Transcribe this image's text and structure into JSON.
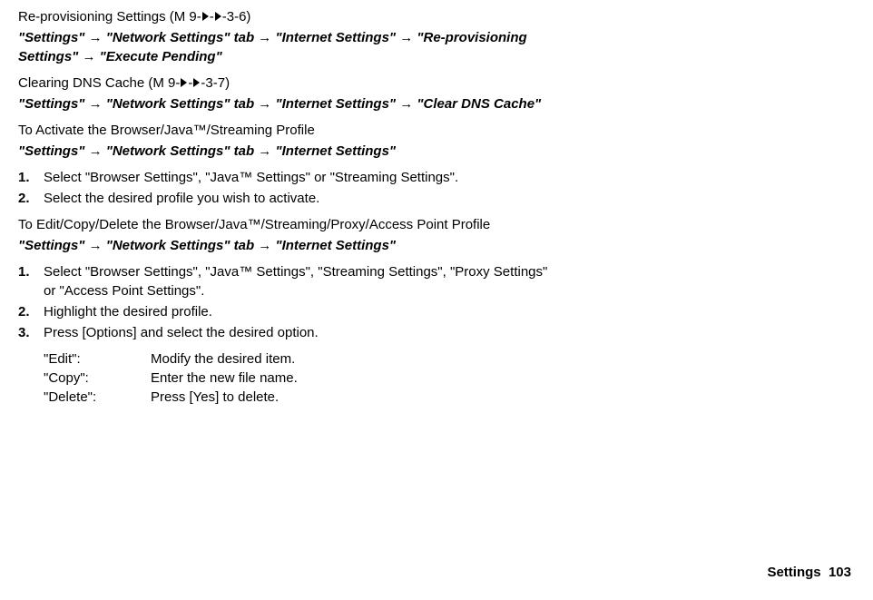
{
  "section1": {
    "title_prefix": "Re-provisioning Settings (M 9-",
    "title_suffix": "-3-6)",
    "nav": "\"Settings\" → \"Network Settings\" tab → \"Internet Settings\" → \"Re-provisioning Settings\" → \"Execute Pending\""
  },
  "section2": {
    "title_prefix": "Clearing DNS Cache (M 9-",
    "title_suffix": "-3-7)",
    "nav": "\"Settings\" → \"Network Settings\" tab → \"Internet Settings\" → \"Clear DNS Cache\""
  },
  "section3": {
    "subtitle": "To Activate the Browser/Java™/Streaming Profile",
    "nav": "\"Settings\" → \"Network Settings\" tab → \"Internet Settings\"",
    "steps": {
      "n1": "1.",
      "s1": "Select \"Browser Settings\", \"Java™ Settings\" or \"Streaming Settings\".",
      "n2": "2.",
      "s2": "Select the desired profile you wish to activate."
    }
  },
  "section4": {
    "subtitle": "To Edit/Copy/Delete the Browser/Java™/Streaming/Proxy/Access Point Profile",
    "nav": "\"Settings\" → \"Network Settings\" tab → \"Internet Settings\"",
    "steps": {
      "n1": "1.",
      "s1": "Select \"Browser Settings\", \"Java™ Settings\", \"Streaming Settings\", \"Proxy Settings\" or \"Access Point Settings\".",
      "n2": "2.",
      "s2": "Highlight the desired profile.",
      "n3": "3.",
      "s3": "Press [Options] and select the desired option."
    },
    "options": {
      "edit_label": "\"Edit\":",
      "edit_desc": "Modify the desired item.",
      "copy_label": "\"Copy\":",
      "copy_desc": "Enter the new file name.",
      "delete_label": "\"Delete\":",
      "delete_desc": "Press [Yes] to delete."
    }
  },
  "footer": {
    "label": "Settings",
    "pagenum": "103"
  }
}
